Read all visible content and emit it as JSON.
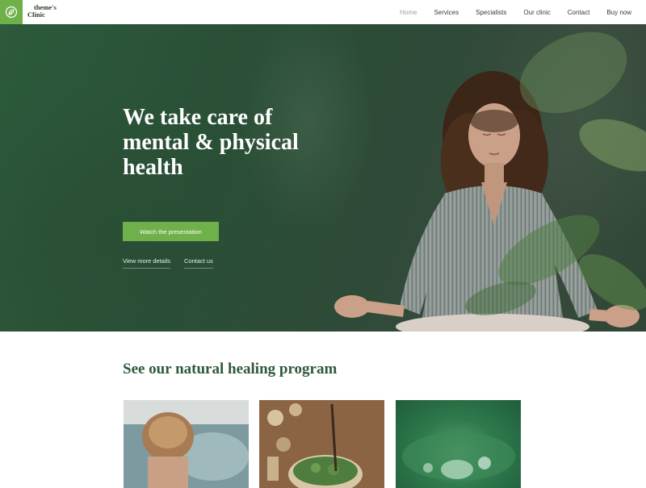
{
  "header": {
    "logo_line1": "theme's",
    "logo_line2": "Clinic",
    "logo_icon": "leaf-icon",
    "nav": [
      {
        "label": "Home",
        "active": true
      },
      {
        "label": "Services",
        "active": false
      },
      {
        "label": "Specialists",
        "active": false
      },
      {
        "label": "Our clinic",
        "active": false
      },
      {
        "label": "Contact",
        "active": false
      },
      {
        "label": "Buy now",
        "active": false
      }
    ]
  },
  "hero": {
    "title_line1": "We take care of",
    "title_line2": "mental & physical",
    "title_line3": "health",
    "cta_label": "Watch the presentation",
    "link_details": "View more details",
    "link_contact": "Contact us"
  },
  "program": {
    "title": "See our natural healing program"
  },
  "colors": {
    "accent": "#6fb04b",
    "hero_bg": "#2d5a3b",
    "heading_green": "#2f5a3a"
  }
}
